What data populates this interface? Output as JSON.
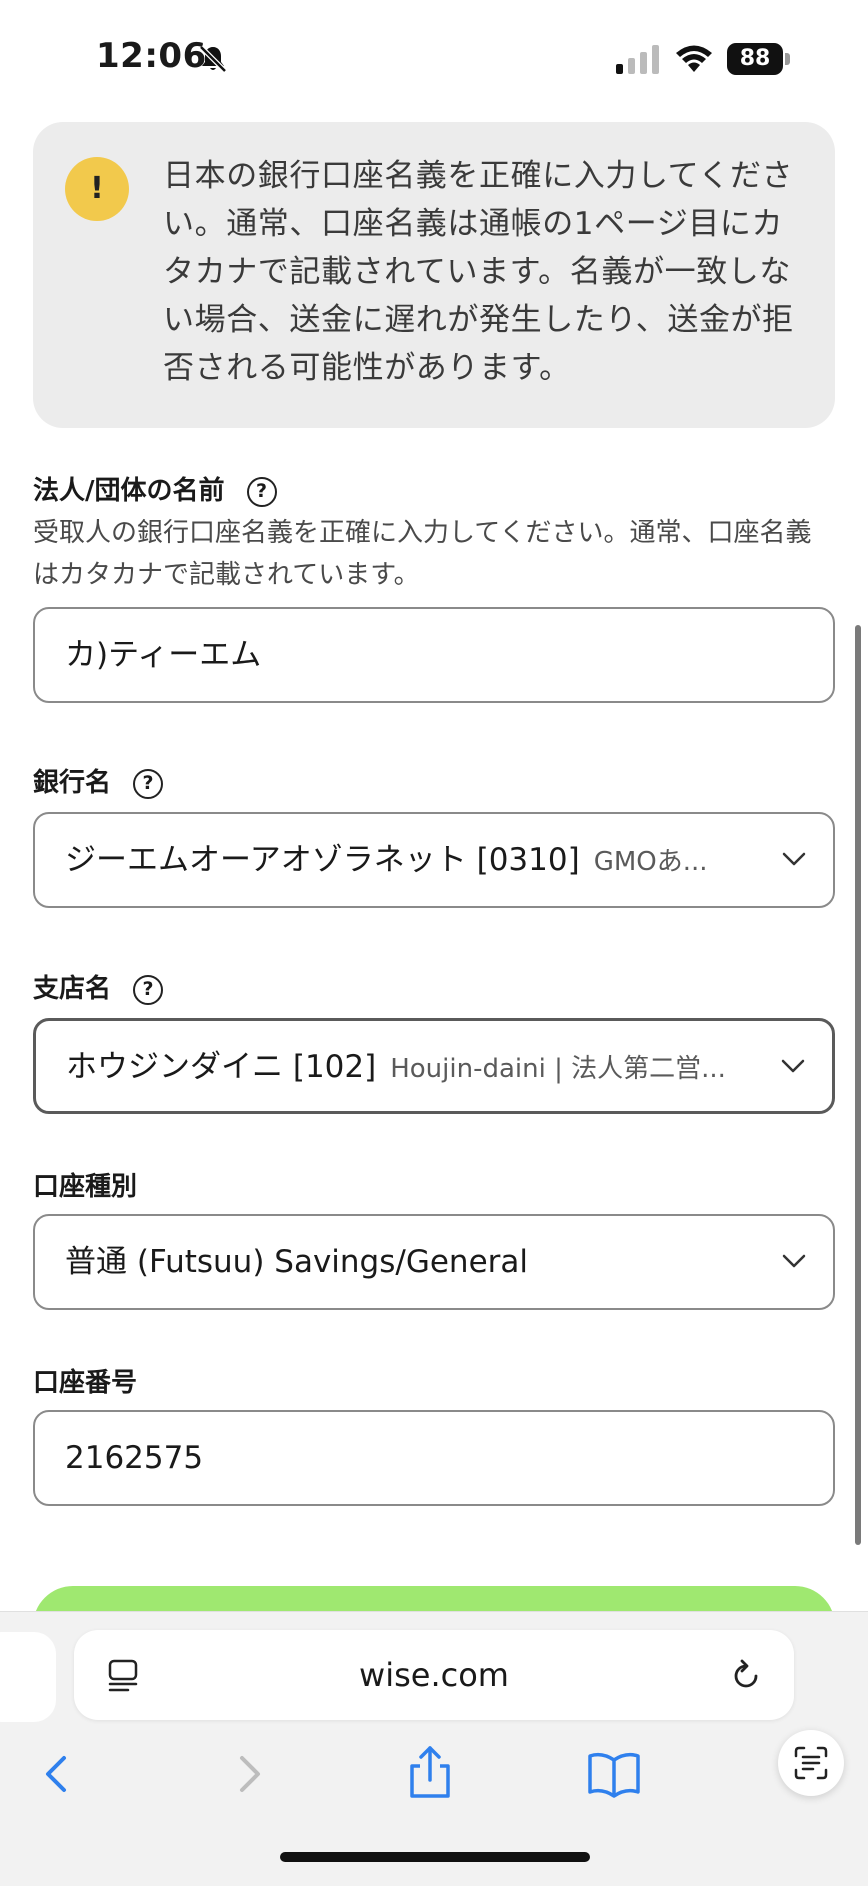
{
  "status_bar": {
    "time": "12:06",
    "battery": "88",
    "icons": [
      "bell-slash-icon",
      "signal-icon",
      "wifi-icon",
      "battery-icon"
    ]
  },
  "alert": {
    "icon": "!",
    "text": "日本の銀行口座名義を正確に入力してください。通常、口座名義は通帳の1ページ目にカタカナで記載されています。名義が一致しない場合、送金に遅れが発生したり、送金が拒否される可能性があります。",
    "color": "#f2c94c"
  },
  "form": {
    "company_name": {
      "label": "法人/団体の名前",
      "help": "?",
      "description": "受取人の銀行口座名義を正確に入力してください。通常、口座名義はカタカナで記載されています。",
      "value": "カ)ティーエム"
    },
    "bank_name": {
      "label": "銀行名",
      "help": "?",
      "value": "ジーエムオーアオゾラネット [0310]",
      "sub": "GMOあ..."
    },
    "branch_name": {
      "label": "支店名",
      "help": "?",
      "value": "ホウジンダイニ [102]",
      "sub": "Houjin-daini | 法人第二営..."
    },
    "account_type": {
      "label": "口座種別",
      "value": "普通 (Futsuu) Savings/General"
    },
    "account_number": {
      "label": "口座番号",
      "value": "2162575"
    }
  },
  "primary_button_color": "#9fe870",
  "browser": {
    "url": "wise.com",
    "toolbar_icons": [
      "back-icon",
      "forward-icon",
      "share-icon",
      "bookmarks-icon",
      "scan-text-icon"
    ]
  }
}
